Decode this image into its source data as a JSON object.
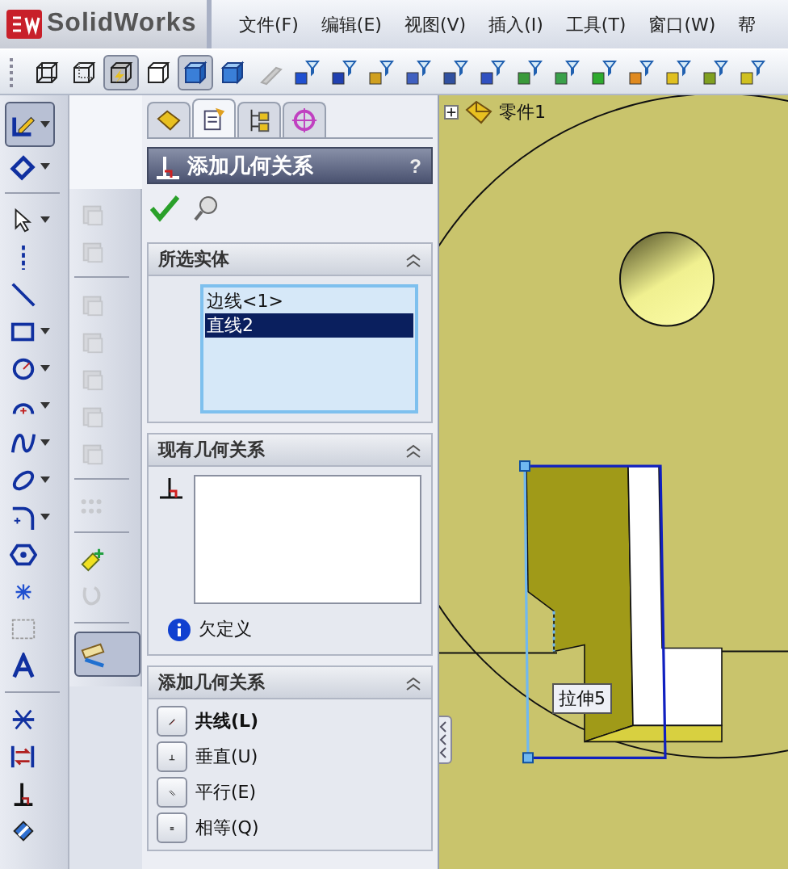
{
  "app": {
    "title": "SolidWorks"
  },
  "menu": [
    "文件(F)",
    "编辑(E)",
    "视图(V)",
    "插入(I)",
    "工具(T)",
    "窗口(W)",
    "帮"
  ],
  "view_toolbar": [
    {
      "kind": "wire-cube",
      "selected": false
    },
    {
      "kind": "dashed-cube",
      "selected": false
    },
    {
      "kind": "bolt-cube",
      "selected": true
    },
    {
      "kind": "plain-cube",
      "selected": false
    },
    {
      "kind": "shaded-cube",
      "selected": true
    },
    {
      "kind": "shaded-cube",
      "selected": false
    },
    {
      "kind": "gray-prism",
      "selected": false
    },
    {
      "kind": "filter",
      "selected": false
    },
    {
      "kind": "filter",
      "selected": false
    },
    {
      "kind": "filter",
      "selected": false
    },
    {
      "kind": "filter",
      "selected": false
    },
    {
      "kind": "filter",
      "selected": false
    },
    {
      "kind": "filter",
      "selected": false
    },
    {
      "kind": "filter",
      "selected": false
    },
    {
      "kind": "filter",
      "selected": false
    },
    {
      "kind": "filter",
      "selected": false
    },
    {
      "kind": "filter",
      "selected": false
    },
    {
      "kind": "filter",
      "selected": false
    },
    {
      "kind": "filter",
      "selected": false
    },
    {
      "kind": "filter",
      "selected": false
    }
  ],
  "sketch_toolbar": [
    {
      "kind": "sketch",
      "selected": true
    },
    {
      "kind": "dimension",
      "selected": false
    },
    {
      "kind": "sep"
    },
    {
      "kind": "pointer",
      "selected": false
    },
    {
      "kind": "centerline",
      "selected": false
    },
    {
      "kind": "line",
      "selected": false
    },
    {
      "kind": "rectangle",
      "selected": false
    },
    {
      "kind": "circle",
      "selected": false
    },
    {
      "kind": "arc",
      "selected": false
    },
    {
      "kind": "spline",
      "selected": false
    },
    {
      "kind": "ellipse",
      "selected": false
    },
    {
      "kind": "fillet",
      "selected": false
    },
    {
      "kind": "polygon",
      "selected": false
    },
    {
      "kind": "point",
      "selected": false
    },
    {
      "kind": "dashed-rect",
      "selected": false
    },
    {
      "kind": "text",
      "selected": false
    },
    {
      "kind": "sep"
    },
    {
      "kind": "trim",
      "selected": false
    },
    {
      "kind": "convert",
      "selected": false
    },
    {
      "kind": "relation",
      "selected": false
    },
    {
      "kind": "repair",
      "selected": false
    }
  ],
  "tools_toolbar": [
    {
      "kind": "block",
      "disabled": true
    },
    {
      "kind": "block",
      "disabled": true
    },
    {
      "kind": "sep"
    },
    {
      "kind": "block",
      "disabled": true
    },
    {
      "kind": "block",
      "disabled": true
    },
    {
      "kind": "block",
      "disabled": true
    },
    {
      "kind": "block",
      "disabled": true
    },
    {
      "kind": "block",
      "disabled": true
    },
    {
      "kind": "sep"
    },
    {
      "kind": "pattern",
      "disabled": true
    },
    {
      "kind": "sep"
    },
    {
      "kind": "move",
      "disabled": false
    },
    {
      "kind": "curve",
      "disabled": true
    },
    {
      "kind": "sep"
    },
    {
      "kind": "measure",
      "disabled": false,
      "selected": true
    }
  ],
  "property_manager": {
    "tabs": [
      {
        "selected": false
      },
      {
        "selected": true
      },
      {
        "selected": false
      },
      {
        "selected": false
      }
    ],
    "title": "添加几何关系",
    "help": "?",
    "sections": [
      {
        "kind": "list",
        "title": "所选实体",
        "items": [
          {
            "label": "边线<1>",
            "selected": false
          },
          {
            "label": "直线2",
            "selected": true
          }
        ]
      },
      {
        "kind": "existing",
        "title": "现有几何关系",
        "status": "欠定义"
      },
      {
        "kind": "buttons",
        "title": "添加几何关系",
        "items": [
          {
            "label": "共线(L)",
            "kind": "collinear",
            "default": true
          },
          {
            "label": "垂直(U)",
            "kind": "perpendicular",
            "default": false
          },
          {
            "label": "平行(E)",
            "kind": "parallel",
            "default": false
          },
          {
            "label": "相等(Q)",
            "kind": "equal",
            "default": false
          }
        ]
      }
    ]
  },
  "viewport": {
    "tree": {
      "label": "零件1",
      "expanded": false
    },
    "tooltip": "拉伸5"
  }
}
